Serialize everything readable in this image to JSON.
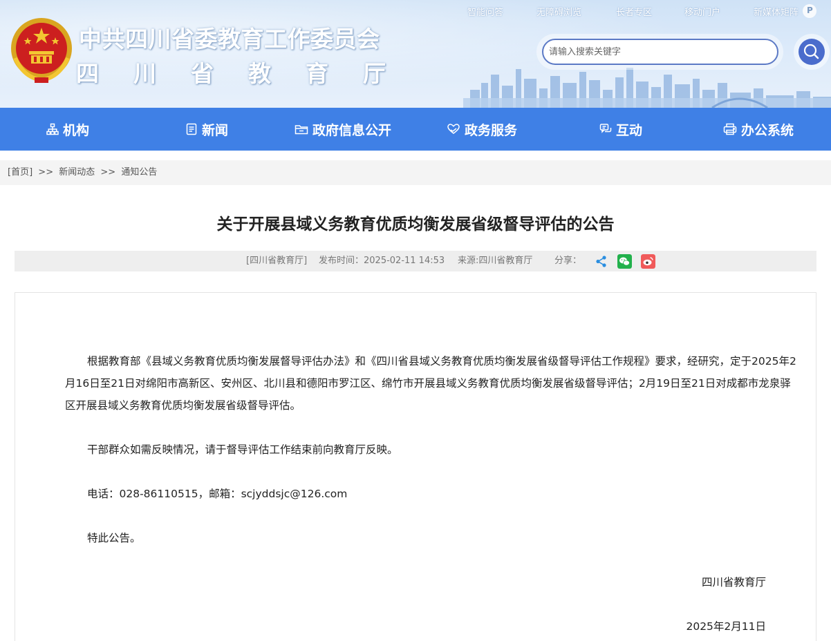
{
  "header": {
    "title_top": "中共四川省委教育工作委员会",
    "title_bottom": "四川省教育厅",
    "top_links": [
      "智能问答",
      "无障碍浏览",
      "长者专区",
      "移动门户",
      "新媒体矩阵"
    ],
    "search_placeholder": "请输入搜索关键字",
    "icons": [
      "national-emblem-icon",
      "search-icon",
      "media-matrix-icon"
    ]
  },
  "nav": {
    "items": [
      {
        "label": "机构",
        "icon": "org-chart-icon"
      },
      {
        "label": "新闻",
        "icon": "document-icon"
      },
      {
        "label": "政府信息公开",
        "icon": "folder-icon"
      },
      {
        "label": "政务服务",
        "icon": "heart-hand-icon"
      },
      {
        "label": "互动",
        "icon": "chat-icon"
      },
      {
        "label": "办公系统",
        "icon": "printer-icon"
      }
    ],
    "color": "#3f80e6"
  },
  "breadcrumb": {
    "home": "[首页]",
    "sep": ">>",
    "level1": "新闻动态",
    "level2": "通知公告"
  },
  "article": {
    "title": "关于开展县域义务教育优质均衡发展省级督导评估的公告",
    "meta": {
      "publisher": "[四川省教育厅]",
      "time": "发布时间：2025-02-11 14:53",
      "source": "来源:四川省教育厅",
      "share_label": "分享："
    },
    "share_icons": [
      "share-icon",
      "wechat-icon",
      "weibo-icon"
    ],
    "paragraphs": [
      "根据教育部《县域义务教育优质均衡发展督导评估办法》和《四川省县域义务教育优质均衡发展省级督导评估工作规程》要求，经研究，定于2025年2月16日至21日对绵阳市高新区、安州区、北川县和德阳市罗江区、绵竹市开展县域义务教育优质均衡发展省级督导评估；2月19日至21日对成都市龙泉驿区开展县域义务教育优质均衡发展省级督导评估。",
      "干部群众如需反映情况，请于督导评估工作结束前向教育厅反映。",
      "电话：028-86110515，邮箱：scjyddsjc@126.com",
      "特此公告。"
    ],
    "signature": "四川省教育厅",
    "date": "2025年2月11日"
  }
}
